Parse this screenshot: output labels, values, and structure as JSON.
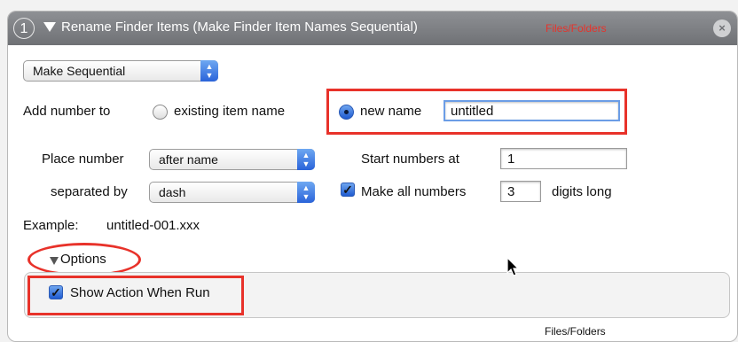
{
  "action": {
    "step_number": "1",
    "title": "Rename Finder Items (Make Finder Item Names Sequential)",
    "category": "Files/Folders",
    "close_icon": "close-icon"
  },
  "mode_popup": {
    "value": "Make Sequential"
  },
  "add_number": {
    "label": "Add number to",
    "existing_option": "existing item name",
    "new_option": "new name",
    "selected": "new name",
    "new_name_value": "untitled"
  },
  "place_number": {
    "label": "Place number",
    "value": "after name"
  },
  "separated_by": {
    "label": "separated by",
    "value": "dash"
  },
  "start_numbers": {
    "label": "Start numbers at",
    "value": "1"
  },
  "make_all_numbers": {
    "label": "Make all numbers",
    "value": "3",
    "suffix": "digits long",
    "checked": true
  },
  "example": {
    "label": "Example:",
    "value": "untitled-001.xxx"
  },
  "options": {
    "label": "Options",
    "show_action_label": "Show Action When Run",
    "show_action_checked": true
  },
  "footer": {
    "category": "Files/Folders"
  },
  "colors": {
    "highlight": "#e8322a",
    "titlebar": "#7b7d81",
    "accent": "#2a63d9"
  }
}
